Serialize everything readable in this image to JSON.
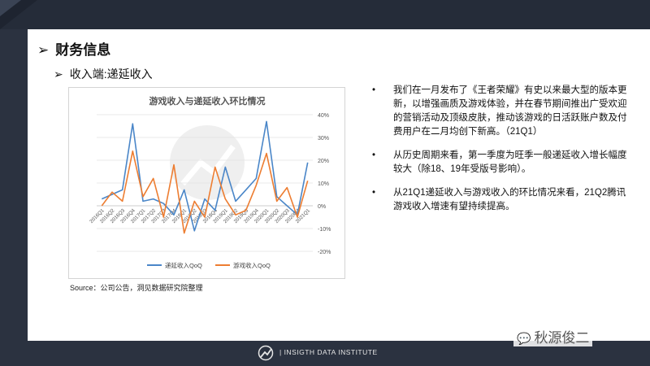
{
  "page": {
    "title": "财务信息",
    "subtitle": "收入端:递延收入",
    "source": "Source：公司公告，洞见数据研究院整理",
    "footer": "| INSIGTH DATA INSTITUTE",
    "watermark": "秋源俊二"
  },
  "bullets": [
    "我们在一月发布了《王者荣耀》有史以来最大型的版本更新，以增强画质及游戏体验，并在春节期间推出广受欢迎的营销活动及顶级皮肤，推动该游戏的日活跃账户数及付费用户在二月均创下新高。（21Q1）",
    "从历史周期来看，第一季度为旺季一般递延收入增长幅度较大（除18、19年受版号影响）。",
    "从21Q1递延收入与游戏收入的环比情况来看，21Q2腾讯游戏收入增速有望持续提高。"
  ],
  "colors": {
    "deferred": "#4a86c8",
    "game": "#ed7d31",
    "grid": "#e3e3e3"
  },
  "chart_data": {
    "type": "line",
    "title": "游戏收入与递延收入环比情况",
    "categories": [
      "2016Q1",
      "2016Q2",
      "2016Q3",
      "2016Q4",
      "2017Q1",
      "2017Q2",
      "2017Q3",
      "2017Q4",
      "2018Q1",
      "2018Q2",
      "2018Q3",
      "2018Q4",
      "2019Q1",
      "2019Q2",
      "2019Q3",
      "2019Q4",
      "2020Q1",
      "2020Q2",
      "2020Q3",
      "2020Q4",
      "2021Q1"
    ],
    "yticks": [
      "40%",
      "30%",
      "20%",
      "10%",
      "0%",
      "-10%",
      "-20%"
    ],
    "ylim": [
      -20,
      40
    ],
    "series": [
      {
        "name": "递延收入QoQ",
        "values": [
          3,
          5,
          7,
          36,
          2,
          3,
          1,
          -4,
          7,
          -11,
          3,
          -2,
          17,
          2,
          7,
          12,
          37,
          4,
          0,
          -4,
          19
        ]
      },
      {
        "name": "游戏收入QoQ",
        "values": [
          0,
          6,
          2,
          24,
          4,
          12,
          -5,
          18,
          -12,
          2,
          -5,
          17,
          3,
          -4,
          -2,
          9,
          23,
          2,
          8,
          -5,
          11
        ]
      }
    ]
  }
}
